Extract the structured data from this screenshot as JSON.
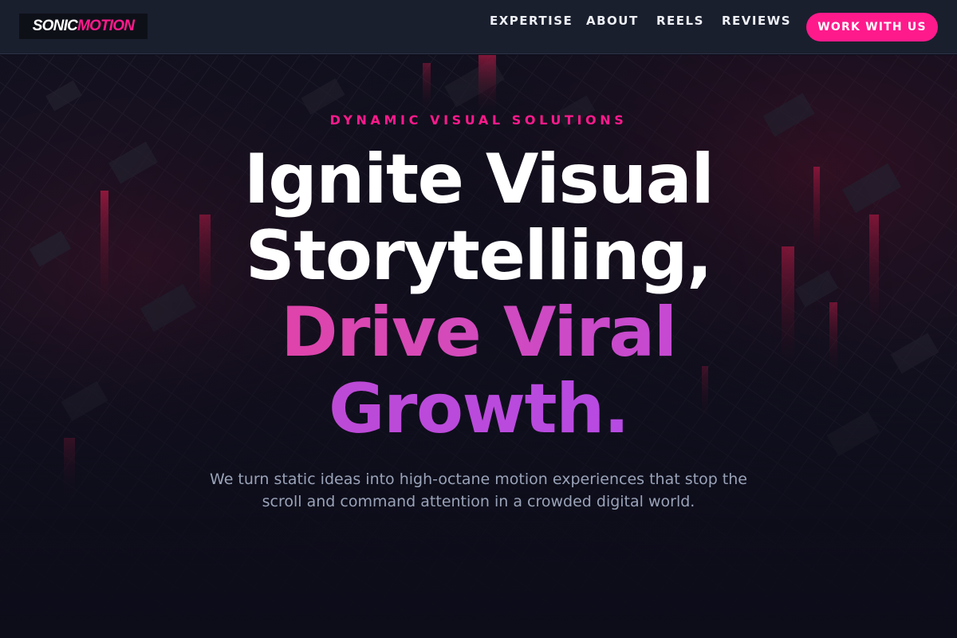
{
  "header": {
    "logo": {
      "part1": "SONIC",
      "part2": "MOTION"
    },
    "nav": [
      {
        "label": "EXPERTISE"
      },
      {
        "label": "ABOUT"
      },
      {
        "label": "REELS"
      },
      {
        "label": "REVIEWS"
      }
    ],
    "cta_label": "WORK WITH US"
  },
  "hero": {
    "eyebrow": "DYNAMIC VISUAL SOLUTIONS",
    "headline": {
      "line1": "Ignite Visual",
      "line2": "Storytelling,",
      "line3": "Drive Viral",
      "line4": "Growth."
    },
    "subtext": "We turn static ideas into high-octane motion experiences that stop the scroll and command attention in a crowded digital world."
  },
  "colors": {
    "accent": "#ff1a8c",
    "header_bg": "#1a1f2e",
    "page_bg": "#0d0d1a",
    "gradient_start": "#f0368f",
    "gradient_end": "#b04bf0",
    "subtext": "#9aa3b8"
  }
}
